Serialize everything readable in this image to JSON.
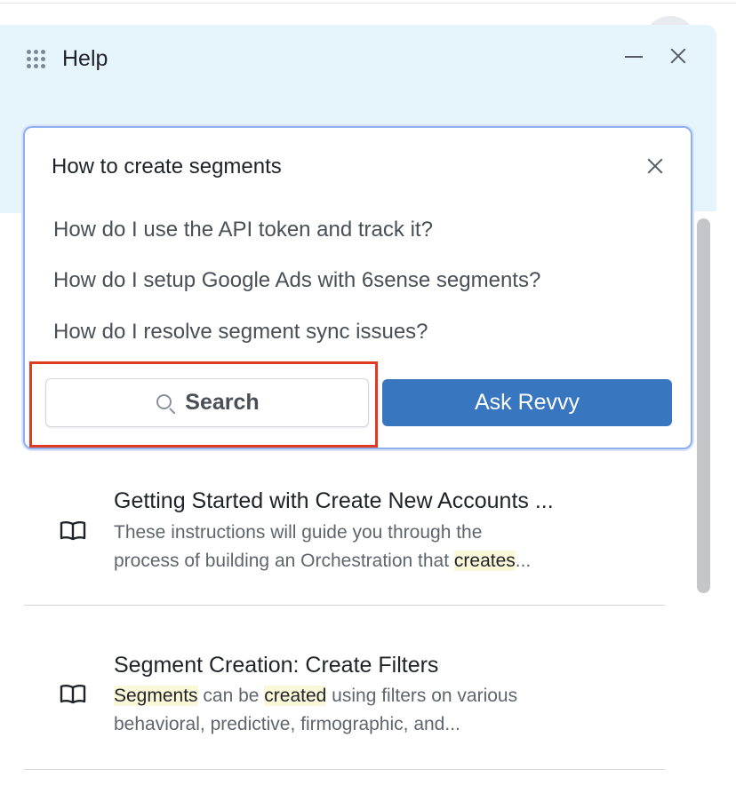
{
  "header": {
    "title": "Help"
  },
  "search": {
    "query": "How to create segments",
    "suggestions": [
      "How do I use the API token and track it?",
      "How do I setup Google Ads with 6sense segments?",
      "How do I resolve segment sync issues?"
    ],
    "search_button": "Search",
    "ask_button": "Ask Revvy"
  },
  "articles": [
    {
      "title": "Getting Started with Create New Accounts ...",
      "snippet_1": "These instructions will guide you through the",
      "snippet_2a": "process of building an Orchestration that ",
      "snippet_2b": "creates",
      "snippet_2c": "..."
    },
    {
      "title": "Segment Creation: Create Filters",
      "snippet_1a": "Segments",
      "snippet_1b": " can be ",
      "snippet_1c": "created",
      "snippet_1d": " using filters on various",
      "snippet_2": "behavioral, predictive, firmographic, and..."
    }
  ],
  "colors": {
    "header_bg": "#e6f4fb",
    "accent_button": "#3877c0",
    "annotation_box": "#e03b22",
    "text_highlight": "#fbf8d9"
  },
  "icons": [
    "grid-icon",
    "minimize-icon",
    "close-icon",
    "clear-icon",
    "search-icon",
    "book-icon"
  ]
}
